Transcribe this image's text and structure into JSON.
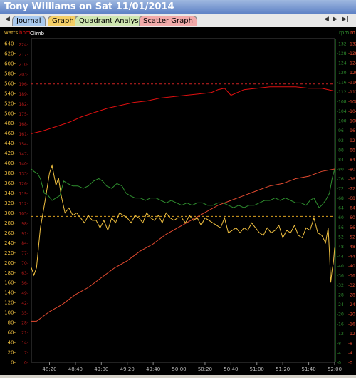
{
  "window": {
    "title": "Tony Williams on Sat 11/01/2014"
  },
  "tabs": [
    {
      "label": "Journal",
      "color": "#a9c9ee"
    },
    {
      "label": "Graph",
      "color": "#f5cf66"
    },
    {
      "label": "Quadrant Analysis",
      "color": "#cfe6b0"
    },
    {
      "label": "Scatter Graph",
      "color": "#f2a9a9"
    }
  ],
  "nav": {
    "first": "|◀",
    "prev": "◀",
    "next": "▶",
    "last": "▶|"
  },
  "chart_data": {
    "type": "line",
    "header_labels": {
      "left_units": "watts",
      "bpm": "bpm",
      "climb": "Climb",
      "rpm": "rpm",
      "right_m": "m"
    },
    "x": {
      "ticks": [
        "48:20",
        "48:40",
        "49:00",
        "49:20",
        "49:40",
        "50:00",
        "50:20",
        "50:40",
        "51:00",
        "51:20",
        "51:40",
        "52:00"
      ],
      "tick_seconds": [
        2900,
        2920,
        2940,
        2960,
        2980,
        3000,
        3020,
        3040,
        3060,
        3080,
        3100,
        3120
      ],
      "range": [
        2886,
        3120
      ]
    },
    "axes": {
      "watts": {
        "range": [
          0,
          650
        ],
        "ticks": [
          0,
          20,
          40,
          60,
          80,
          100,
          120,
          140,
          160,
          180,
          200,
          220,
          240,
          260,
          280,
          300,
          320,
          340,
          360,
          380,
          400,
          420,
          440,
          460,
          480,
          500,
          520,
          540,
          560,
          580,
          600,
          620,
          640
        ]
      },
      "bpm": {
        "range": [
          0,
          228
        ],
        "ticks": [
          0,
          7,
          14,
          21,
          28,
          35,
          42,
          49,
          56,
          63,
          70,
          77,
          84,
          91,
          98,
          105,
          112,
          119,
          126,
          133,
          140,
          147,
          154,
          161,
          168,
          175,
          182,
          189,
          196,
          203,
          210,
          217,
          224
        ]
      },
      "rpm": {
        "range": [
          0,
          134
        ],
        "ticks": [
          0,
          4,
          8,
          12,
          16,
          20,
          24,
          28,
          32,
          36,
          40,
          44,
          48,
          52,
          56,
          60,
          64,
          68,
          72,
          76,
          80,
          84,
          88,
          92,
          96,
          100,
          104,
          108,
          112,
          116,
          120,
          124,
          128,
          132
        ]
      },
      "m": {
        "range": [
          0,
          134
        ],
        "ticks": [
          0,
          4,
          8,
          12,
          16,
          20,
          24,
          28,
          32,
          36,
          40,
          44,
          48,
          52,
          56,
          60,
          64,
          68,
          72,
          76,
          80,
          84,
          88,
          92,
          96,
          100,
          104,
          108,
          112,
          116,
          120,
          124,
          128,
          132
        ]
      }
    },
    "reference_lines": [
      {
        "name": "hr_ref",
        "axis": "bpm",
        "value": 196,
        "color": "#cc2222"
      },
      {
        "name": "power_ref",
        "axis": "watts",
        "value": 293,
        "color": "#d9a020"
      }
    ],
    "series": [
      {
        "key": "heart_rate",
        "axis": "bpm",
        "color": "#e01010",
        "points": [
          [
            2886,
            161
          ],
          [
            2895,
            163
          ],
          [
            2905,
            166
          ],
          [
            2915,
            169
          ],
          [
            2925,
            173
          ],
          [
            2935,
            176
          ],
          [
            2945,
            179
          ],
          [
            2955,
            181
          ],
          [
            2965,
            183
          ],
          [
            2975,
            184
          ],
          [
            2985,
            186
          ],
          [
            2995,
            187
          ],
          [
            3005,
            188
          ],
          [
            3015,
            189
          ],
          [
            3025,
            190
          ],
          [
            3030,
            192
          ],
          [
            3035,
            193
          ],
          [
            3040,
            188
          ],
          [
            3045,
            190
          ],
          [
            3050,
            192
          ],
          [
            3060,
            193
          ],
          [
            3070,
            194
          ],
          [
            3080,
            194
          ],
          [
            3090,
            194
          ],
          [
            3100,
            193
          ],
          [
            3110,
            193
          ],
          [
            3115,
            192
          ],
          [
            3120,
            191
          ]
        ]
      },
      {
        "key": "power",
        "axis": "watts",
        "color": "#f0c040",
        "points": [
          [
            2886,
            190
          ],
          [
            2888,
            175
          ],
          [
            2890,
            190
          ],
          [
            2893,
            270
          ],
          [
            2897,
            330
          ],
          [
            2900,
            380
          ],
          [
            2902,
            395
          ],
          [
            2905,
            355
          ],
          [
            2907,
            370
          ],
          [
            2909,
            335
          ],
          [
            2912,
            300
          ],
          [
            2915,
            310
          ],
          [
            2918,
            295
          ],
          [
            2921,
            300
          ],
          [
            2924,
            290
          ],
          [
            2927,
            280
          ],
          [
            2930,
            295
          ],
          [
            2933,
            285
          ],
          [
            2936,
            285
          ],
          [
            2939,
            270
          ],
          [
            2942,
            285
          ],
          [
            2945,
            265
          ],
          [
            2948,
            290
          ],
          [
            2951,
            280
          ],
          [
            2954,
            300
          ],
          [
            2957,
            295
          ],
          [
            2960,
            290
          ],
          [
            2963,
            280
          ],
          [
            2966,
            295
          ],
          [
            2969,
            290
          ],
          [
            2972,
            280
          ],
          [
            2975,
            300
          ],
          [
            2978,
            290
          ],
          [
            2981,
            285
          ],
          [
            2984,
            295
          ],
          [
            2987,
            280
          ],
          [
            2990,
            300
          ],
          [
            2993,
            290
          ],
          [
            2996,
            285
          ],
          [
            2999,
            290
          ],
          [
            3002,
            290
          ],
          [
            3005,
            280
          ],
          [
            3008,
            295
          ],
          [
            3011,
            285
          ],
          [
            3014,
            290
          ],
          [
            3017,
            275
          ],
          [
            3020,
            290
          ],
          [
            3023,
            285
          ],
          [
            3026,
            280
          ],
          [
            3029,
            275
          ],
          [
            3032,
            270
          ],
          [
            3035,
            290
          ],
          [
            3038,
            260
          ],
          [
            3041,
            265
          ],
          [
            3044,
            270
          ],
          [
            3047,
            260
          ],
          [
            3050,
            270
          ],
          [
            3053,
            265
          ],
          [
            3056,
            280
          ],
          [
            3059,
            270
          ],
          [
            3062,
            260
          ],
          [
            3065,
            255
          ],
          [
            3068,
            270
          ],
          [
            3071,
            260
          ],
          [
            3074,
            265
          ],
          [
            3077,
            275
          ],
          [
            3080,
            250
          ],
          [
            3083,
            265
          ],
          [
            3086,
            260
          ],
          [
            3089,
            275
          ],
          [
            3092,
            255
          ],
          [
            3095,
            250
          ],
          [
            3098,
            270
          ],
          [
            3101,
            265
          ],
          [
            3104,
            290
          ],
          [
            3107,
            260
          ],
          [
            3110,
            255
          ],
          [
            3113,
            240
          ],
          [
            3115,
            270
          ],
          [
            3116,
            220
          ],
          [
            3117,
            160
          ],
          [
            3118,
            185
          ],
          [
            3119,
            200
          ],
          [
            3120,
            230
          ]
        ]
      },
      {
        "key": "cadence",
        "axis": "rpm",
        "color": "#2f8f2f",
        "points": [
          [
            2886,
            80
          ],
          [
            2888,
            79
          ],
          [
            2891,
            78
          ],
          [
            2893,
            76
          ],
          [
            2896,
            70
          ],
          [
            2899,
            69
          ],
          [
            2902,
            67
          ],
          [
            2905,
            68
          ],
          [
            2908,
            69
          ],
          [
            2911,
            75
          ],
          [
            2914,
            74
          ],
          [
            2918,
            73
          ],
          [
            2922,
            73
          ],
          [
            2926,
            72
          ],
          [
            2930,
            73
          ],
          [
            2934,
            75
          ],
          [
            2938,
            76
          ],
          [
            2941,
            75
          ],
          [
            2944,
            73
          ],
          [
            2948,
            72
          ],
          [
            2952,
            74
          ],
          [
            2956,
            73
          ],
          [
            2959,
            70
          ],
          [
            2962,
            69
          ],
          [
            2966,
            68
          ],
          [
            2970,
            68
          ],
          [
            2974,
            67
          ],
          [
            2978,
            68
          ],
          [
            2982,
            68
          ],
          [
            2986,
            67
          ],
          [
            2990,
            66
          ],
          [
            2994,
            67
          ],
          [
            2998,
            66
          ],
          [
            3002,
            65
          ],
          [
            3006,
            66
          ],
          [
            3010,
            65
          ],
          [
            3014,
            66
          ],
          [
            3018,
            66
          ],
          [
            3022,
            65
          ],
          [
            3026,
            65
          ],
          [
            3030,
            66
          ],
          [
            3034,
            66
          ],
          [
            3038,
            65
          ],
          [
            3042,
            64
          ],
          [
            3046,
            65
          ],
          [
            3050,
            64
          ],
          [
            3054,
            65
          ],
          [
            3058,
            65
          ],
          [
            3062,
            66
          ],
          [
            3066,
            67
          ],
          [
            3070,
            67
          ],
          [
            3074,
            68
          ],
          [
            3078,
            67
          ],
          [
            3082,
            68
          ],
          [
            3086,
            67
          ],
          [
            3090,
            66
          ],
          [
            3094,
            66
          ],
          [
            3098,
            65
          ],
          [
            3101,
            67
          ],
          [
            3104,
            68
          ],
          [
            3106,
            66
          ],
          [
            3108,
            64
          ],
          [
            3110,
            65
          ],
          [
            3113,
            67
          ],
          [
            3116,
            70
          ],
          [
            3118,
            76
          ],
          [
            3120,
            80
          ]
        ]
      },
      {
        "key": "climb",
        "axis": "m",
        "color": "#e24a30",
        "points": [
          [
            2886,
            17
          ],
          [
            2890,
            17
          ],
          [
            2900,
            21
          ],
          [
            2910,
            24
          ],
          [
            2920,
            28
          ],
          [
            2930,
            31
          ],
          [
            2940,
            35
          ],
          [
            2950,
            39
          ],
          [
            2960,
            42
          ],
          [
            2970,
            46
          ],
          [
            2980,
            49
          ],
          [
            2990,
            53
          ],
          [
            3000,
            56
          ],
          [
            3010,
            59
          ],
          [
            3020,
            62
          ],
          [
            3030,
            65
          ],
          [
            3040,
            67
          ],
          [
            3050,
            69
          ],
          [
            3060,
            71
          ],
          [
            3070,
            73
          ],
          [
            3080,
            74
          ],
          [
            3090,
            76
          ],
          [
            3100,
            77
          ],
          [
            3110,
            79
          ],
          [
            3120,
            80
          ]
        ]
      }
    ]
  }
}
